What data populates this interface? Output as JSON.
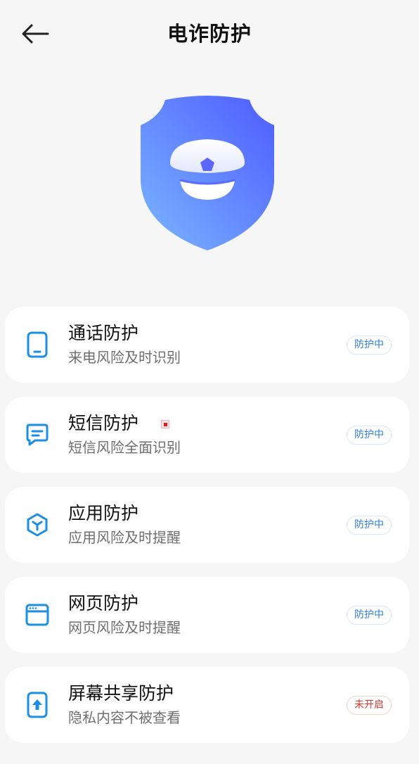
{
  "header": {
    "title": "电诈防护",
    "back_icon": "arrow-left-icon"
  },
  "hero": {
    "icon": "police-cap-shield-icon",
    "colors": {
      "shield_light": "#7ab6ff",
      "shield_dark": "#4e5cff",
      "cap": "#ffffff"
    }
  },
  "colors": {
    "accent": "#1a8fe3",
    "on_badge": "#2f7fd8",
    "off_badge": "#e03a2f"
  },
  "cards": [
    {
      "icon": "phone-icon",
      "title": "通话防护",
      "subtitle": "来电风险及时识别",
      "status": "防护中",
      "on": true
    },
    {
      "icon": "message-icon",
      "title": "短信防护",
      "subtitle": "短信风险全面识别",
      "status": "防护中",
      "on": true
    },
    {
      "icon": "app-cube-icon",
      "title": "应用防护",
      "subtitle": "应用风险及时提醒",
      "status": "防护中",
      "on": true
    },
    {
      "icon": "browser-window-icon",
      "title": "网页防护",
      "subtitle": "网页风险及时提醒",
      "status": "防护中",
      "on": true
    },
    {
      "icon": "screen-share-icon",
      "title": "屏幕共享防护",
      "subtitle": "隐私内容不被查看",
      "status": "未开启",
      "on": false
    }
  ]
}
